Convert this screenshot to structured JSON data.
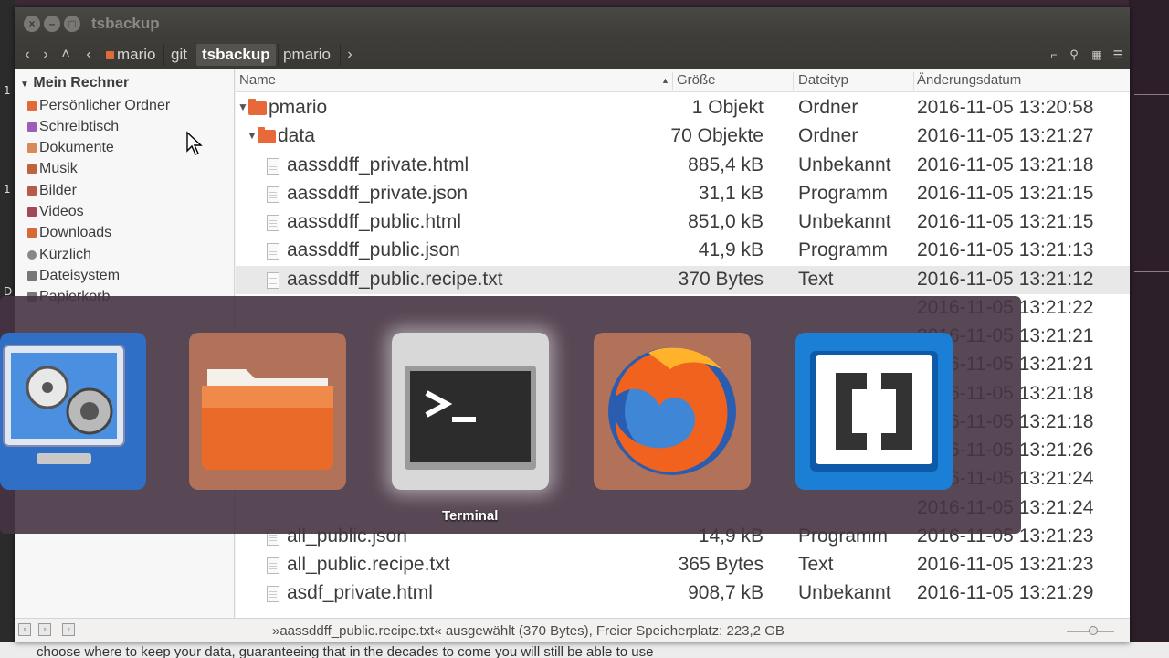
{
  "window": {
    "title": "tsbackup"
  },
  "toolbar": {
    "back": "‹",
    "forward": "›",
    "up": "˄",
    "crumb_left": "‹",
    "crumb_right": "›",
    "breadcrumbs": [
      "mario",
      "git",
      "tsbackup",
      "pmario"
    ],
    "active_crumb": "tsbackup"
  },
  "sidebar": {
    "heading": "Mein Rechner",
    "items": [
      {
        "label": "Persönlicher Ordner",
        "color": "#e06a3a"
      },
      {
        "label": "Schreibtisch",
        "color": "#9c5fb5"
      },
      {
        "label": "Dokumente",
        "color": "#d88a5a"
      },
      {
        "label": "Musik",
        "color": "#c0623a"
      },
      {
        "label": "Bilder",
        "color": "#b85a4a"
      },
      {
        "label": "Videos",
        "color": "#a04a5a"
      },
      {
        "label": "Downloads",
        "color": "#d86a3a"
      },
      {
        "label": "Kürzlich",
        "color": "#888888"
      },
      {
        "label": "Dateisystem",
        "color": "#777777"
      },
      {
        "label": "Papierkorb",
        "color": "#777777"
      }
    ]
  },
  "columns": {
    "name": "Name",
    "size": "Größe",
    "type": "Dateityp",
    "date": "Änderungsdatum"
  },
  "rows": [
    {
      "name": "pmario",
      "size": "1 Objekt",
      "type": "Ordner",
      "date": "2016-11-05 13:20:58"
    },
    {
      "name": "data",
      "size": "70 Objekte",
      "type": "Ordner",
      "date": "2016-11-05 13:21:27"
    },
    {
      "name": "aassddff_private.html",
      "size": "885,4 kB",
      "type": "Unbekannt",
      "date": "2016-11-05 13:21:18"
    },
    {
      "name": "aassddff_private.json",
      "size": "31,1 kB",
      "type": "Programm",
      "date": "2016-11-05 13:21:15"
    },
    {
      "name": "aassddff_public.html",
      "size": "851,0 kB",
      "type": "Unbekannt",
      "date": "2016-11-05 13:21:15"
    },
    {
      "name": "aassddff_public.json",
      "size": "41,9 kB",
      "type": "Programm",
      "date": "2016-11-05 13:21:13"
    },
    {
      "name": "aassddff_public.recipe.txt",
      "size": "370 Bytes",
      "type": "Text",
      "date": "2016-11-05 13:21:12"
    },
    {
      "name": "",
      "size": "",
      "type": "",
      "date": "2016-11-05 13:21:22"
    },
    {
      "name": "",
      "size": "",
      "type": "",
      "date": "2016-11-05 13:21:21"
    },
    {
      "name": "",
      "size": "",
      "type": "",
      "date": "2016-11-05 13:21:21"
    },
    {
      "name": "",
      "size": "",
      "type": "",
      "date": "2016-11-05 13:21:18"
    },
    {
      "name": "",
      "size": "",
      "type": "",
      "date": "2016-11-05 13:21:18"
    },
    {
      "name": "",
      "size": "",
      "type": "",
      "date": "2016-11-05 13:21:26"
    },
    {
      "name": "",
      "size": "",
      "type": "",
      "date": "2016-11-05 13:21:24"
    },
    {
      "name": "",
      "size": "",
      "type": "",
      "date": "2016-11-05 13:21:24"
    },
    {
      "name": "all_public.json",
      "size": "14,9 kB",
      "type": "Programm",
      "date": "2016-11-05 13:21:23"
    },
    {
      "name": "all_public.recipe.txt",
      "size": "365 Bytes",
      "type": "Text",
      "date": "2016-11-05 13:21:23"
    },
    {
      "name": "asdf_private.html",
      "size": "908,7 kB",
      "type": "Unbekannt",
      "date": "2016-11-05 13:21:29"
    }
  ],
  "status": {
    "text": "»aassddff_public.recipe.txt« ausgewählt (370 Bytes), Freier Speicherplatz: 223,2 GB"
  },
  "switcher": {
    "apps": [
      "system-settings-icon",
      "files-icon",
      "terminal-icon",
      "firefox-icon",
      "brackets-icon"
    ],
    "active_label": "Terminal"
  },
  "background": {
    "bottom_text": "choose where to keep your data, guaranteeing that in the decades to come you will still be able to use"
  }
}
